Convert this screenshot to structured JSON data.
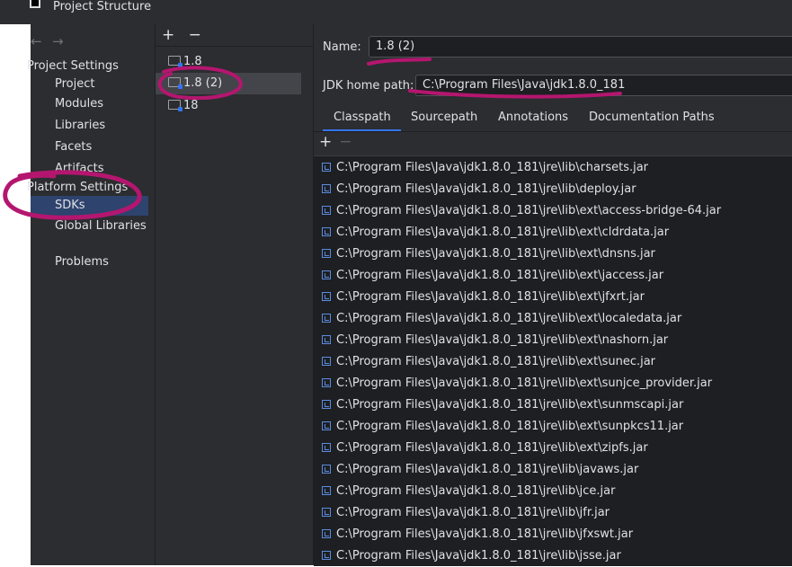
{
  "window": {
    "title": "Project Structure"
  },
  "nav": {
    "back_icon": "arrow-left-icon",
    "forward_icon": "arrow-right-icon"
  },
  "sidebar": {
    "project_settings_header": "Project Settings",
    "project_items": [
      "Project",
      "Modules",
      "Libraries",
      "Facets",
      "Artifacts"
    ],
    "platform_settings_header": "Platform Settings",
    "platform_items": [
      "SDKs",
      "Global Libraries"
    ],
    "selected": "SDKs",
    "problems": "Problems"
  },
  "sdk_list": {
    "add_label": "+",
    "remove_label": "−",
    "items": [
      "1.8",
      "1.8 (2)",
      "18"
    ],
    "selected": "1.8 (2)"
  },
  "main": {
    "name_label": "Name:",
    "name_value": "1.8 (2)",
    "jdk_home_label": "JDK home path:",
    "jdk_home_value": "C:\\Program Files\\Java\\jdk1.8.0_181",
    "tabs": [
      "Classpath",
      "Sourcepath",
      "Annotations",
      "Documentation Paths"
    ],
    "active_tab": "Classpath",
    "add_label": "+",
    "remove_label": "−",
    "classpath": [
      "C:\\Program Files\\Java\\jdk1.8.0_181\\jre\\lib\\charsets.jar",
      "C:\\Program Files\\Java\\jdk1.8.0_181\\jre\\lib\\deploy.jar",
      "C:\\Program Files\\Java\\jdk1.8.0_181\\jre\\lib\\ext\\access-bridge-64.jar",
      "C:\\Program Files\\Java\\jdk1.8.0_181\\jre\\lib\\ext\\cldrdata.jar",
      "C:\\Program Files\\Java\\jdk1.8.0_181\\jre\\lib\\ext\\dnsns.jar",
      "C:\\Program Files\\Java\\jdk1.8.0_181\\jre\\lib\\ext\\jaccess.jar",
      "C:\\Program Files\\Java\\jdk1.8.0_181\\jre\\lib\\ext\\jfxrt.jar",
      "C:\\Program Files\\Java\\jdk1.8.0_181\\jre\\lib\\ext\\localedata.jar",
      "C:\\Program Files\\Java\\jdk1.8.0_181\\jre\\lib\\ext\\nashorn.jar",
      "C:\\Program Files\\Java\\jdk1.8.0_181\\jre\\lib\\ext\\sunec.jar",
      "C:\\Program Files\\Java\\jdk1.8.0_181\\jre\\lib\\ext\\sunjce_provider.jar",
      "C:\\Program Files\\Java\\jdk1.8.0_181\\jre\\lib\\ext\\sunmscapi.jar",
      "C:\\Program Files\\Java\\jdk1.8.0_181\\jre\\lib\\ext\\sunpkcs11.jar",
      "C:\\Program Files\\Java\\jdk1.8.0_181\\jre\\lib\\ext\\zipfs.jar",
      "C:\\Program Files\\Java\\jdk1.8.0_181\\jre\\lib\\javaws.jar",
      "C:\\Program Files\\Java\\jdk1.8.0_181\\jre\\lib\\jce.jar",
      "C:\\Program Files\\Java\\jdk1.8.0_181\\jre\\lib\\jfr.jar",
      "C:\\Program Files\\Java\\jdk1.8.0_181\\jre\\lib\\jfxswt.jar",
      "C:\\Program Files\\Java\\jdk1.8.0_181\\jre\\lib\\jsse.jar"
    ]
  },
  "colors": {
    "panel_bg": "#2b2d30",
    "list_bg": "#1e1f22",
    "selected_nav": "#2e436e",
    "selected_item": "#43454a",
    "accent": "#3574f0",
    "annotation_marker": "#b4166f"
  }
}
